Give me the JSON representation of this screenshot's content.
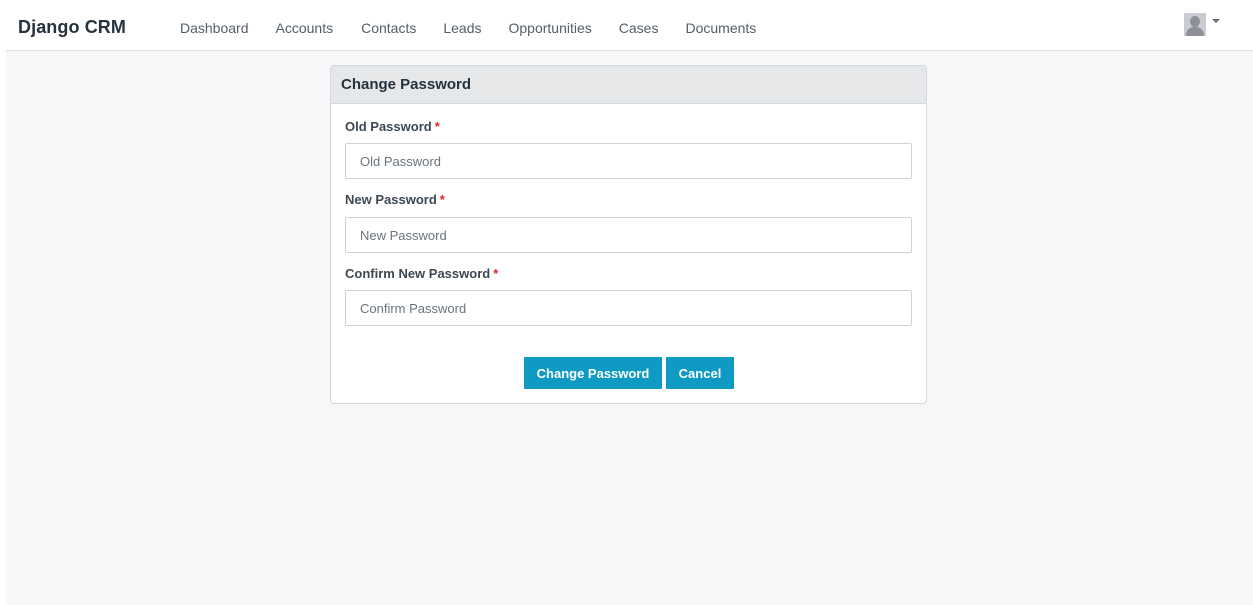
{
  "navbar": {
    "brand": "Django CRM",
    "links": [
      "Dashboard",
      "Accounts",
      "Contacts",
      "Leads",
      "Opportunities",
      "Cases",
      "Documents"
    ]
  },
  "form": {
    "title": "Change Password",
    "required_marker": "*",
    "fields": [
      {
        "label": "Old Password",
        "placeholder": "Old Password"
      },
      {
        "label": "New Password",
        "placeholder": "New Password"
      },
      {
        "label": "Confirm New Password",
        "placeholder": "Confirm Password"
      }
    ],
    "submit_label": "Change Password",
    "cancel_label": "Cancel"
  },
  "colors": {
    "primary_button": "#0e9ac2",
    "required": "#e0262b"
  },
  "icons": {
    "user_menu": "user-avatar-icon",
    "dropdown": "caret-down-icon"
  }
}
